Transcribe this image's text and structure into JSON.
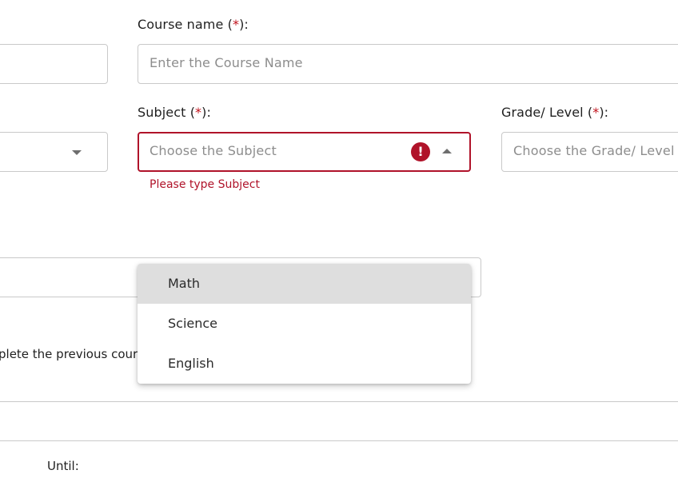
{
  "course_name": {
    "label": "Course name (",
    "required_mark": "*",
    "label_suffix": "):",
    "placeholder": "Enter the Course Name"
  },
  "subject": {
    "label": "Subject (",
    "required_mark": "*",
    "label_suffix": "):",
    "placeholder": "Choose the Subject",
    "error_message": "Please type Subject",
    "options": [
      "Math",
      "Science",
      "English"
    ],
    "highlighted_option": "Math"
  },
  "grade_level": {
    "label": "Grade/ Level (",
    "required_mark": "*",
    "label_suffix": "):",
    "placeholder": "Choose the Grade/ Level"
  },
  "prerequisite_text": "plete the previous cour",
  "until_label": "Until:",
  "colors": {
    "error": "#b0132a",
    "required": "#c0101a",
    "border": "#c9c9c9",
    "option_highlight": "#dedede"
  }
}
